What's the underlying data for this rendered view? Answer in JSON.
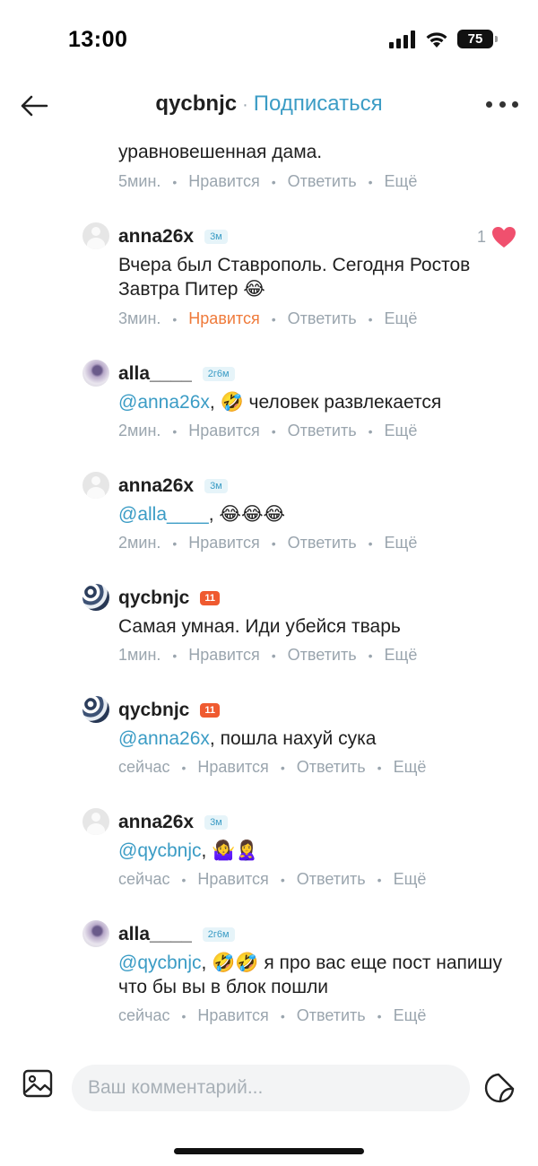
{
  "status_bar": {
    "time": "13:00",
    "battery": "75"
  },
  "header": {
    "username": "qycbnjc",
    "separator": "·",
    "subscribe_label": "Подписаться"
  },
  "comments": [
    {
      "text_partial": "уравновешенная дама.",
      "meta": {
        "time": "5мин.",
        "like": "Нравится",
        "reply": "Ответить",
        "more": "Ещё"
      }
    },
    {
      "username": "anna26x",
      "badge": "3м",
      "text": "Вчера был Ставрополь. Сегодня Ростов Завтра Питер 😂",
      "likes": "1",
      "meta": {
        "time": "3мин.",
        "like": "Нравится",
        "reply": "Ответить",
        "more": "Ещё"
      }
    },
    {
      "username": "alla____",
      "badge": "2г6м",
      "mention": "@anna26x",
      "text": ", 🤣 человек развлекается",
      "meta": {
        "time": "2мин.",
        "like": "Нравится",
        "reply": "Ответить",
        "more": "Ещё"
      }
    },
    {
      "username": "anna26x",
      "badge": "3м",
      "mention": "@alla____",
      "text": ", 😂😂😂",
      "meta": {
        "time": "2мин.",
        "like": "Нравится",
        "reply": "Ответить",
        "more": "Ещё"
      }
    },
    {
      "username": "qycbnjc",
      "badge": "11",
      "text": "Самая умная. Иди убейся тварь",
      "meta": {
        "time": "1мин.",
        "like": "Нравится",
        "reply": "Ответить",
        "more": "Ещё"
      }
    },
    {
      "username": "qycbnjc",
      "badge": "11",
      "mention": "@anna26x",
      "text": ", пошла нахуй сука",
      "meta": {
        "time": "сейчас",
        "like": "Нравится",
        "reply": "Ответить",
        "more": "Ещё"
      }
    },
    {
      "username": "anna26x",
      "badge": "3м",
      "mention": "@qycbnjc",
      "text": ", 🤷‍♀️🙎‍♀️",
      "meta": {
        "time": "сейчас",
        "like": "Нравится",
        "reply": "Ответить",
        "more": "Ещё"
      }
    },
    {
      "username": "alla____",
      "badge": "2г6м",
      "mention": "@qycbnjc",
      "text": ", 🤣🤣 я про вас еще пост напишу что бы вы в блок пошли",
      "meta": {
        "time": "сейчас",
        "like": "Нравится",
        "reply": "Ответить",
        "more": "Ещё"
      }
    }
  ],
  "input": {
    "placeholder": "Ваш комментарий..."
  },
  "colors": {
    "accent": "#3b9cc5",
    "liked": "#ef7a3a",
    "heart": "#f0506e",
    "badge_orange": "#ef5a30",
    "meta_gray": "#9aa5ae"
  }
}
